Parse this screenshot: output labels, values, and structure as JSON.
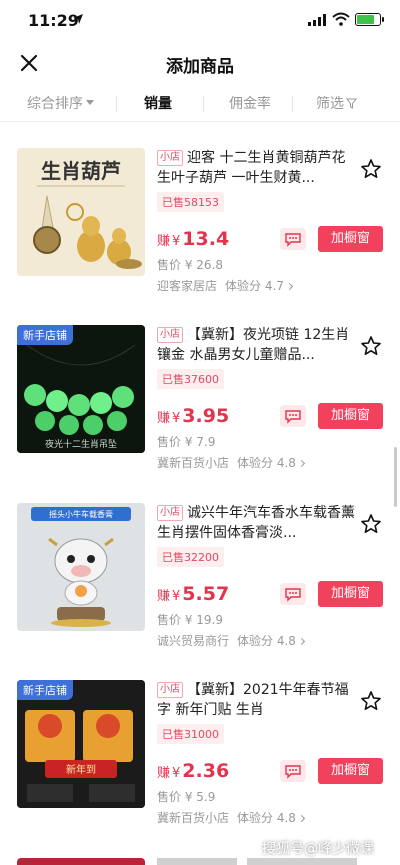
{
  "status": {
    "time": "11:29"
  },
  "header": {
    "title": "添加商品"
  },
  "sort": {
    "comprehensive": "综合排序",
    "sales": "销量",
    "commission": "佣金率",
    "filter": "筛选"
  },
  "common": {
    "shop_tag": "小店",
    "earn_label": "赚",
    "currency": "¥",
    "price_prefix": "售价",
    "score_prefix": "体验分",
    "add_button": "加橱窗",
    "new_badge": "新手店铺"
  },
  "products": [
    {
      "title": "迎客 十二生肖黄铜葫芦花生叶子葫芦 一叶生财黄...",
      "sold": "已售58153",
      "earn": "13.4",
      "price": "¥ 26.8",
      "shop": "迎客家居店",
      "score": "4.7",
      "image_caption": "生肖葫芦",
      "new_shop": false
    },
    {
      "title": "【冀新】夜光项链 12生肖镶金 水晶男女儿童赠品...",
      "sold": "已售37600",
      "earn": "3.95",
      "price": "¥ 7.9",
      "shop": "冀新百货小店",
      "score": "4.8",
      "image_caption": "夜光十二生肖吊坠",
      "new_shop": true
    },
    {
      "title": "诚兴牛年汽车香水车载香薰生肖摆件固体香膏淡...",
      "sold": "已售32200",
      "earn": "5.57",
      "price": "¥ 19.9",
      "shop": "诚兴贸易商行",
      "score": "4.8",
      "image_caption": "摇头小牛车载香膏",
      "new_shop": false
    },
    {
      "title": "【冀新】2021牛年春节福字 新年门贴 生肖",
      "sold": "已售31000",
      "earn": "2.36",
      "price": "¥ 5.9",
      "shop": "冀新百货小店",
      "score": "4.8",
      "image_caption": "新年到",
      "new_shop": true
    }
  ],
  "watermark": "搜狐号@峰少微课",
  "colors": {
    "accent": "#f1415d",
    "earn": "#e2354d",
    "badge_blue": "#3f6fd8"
  }
}
